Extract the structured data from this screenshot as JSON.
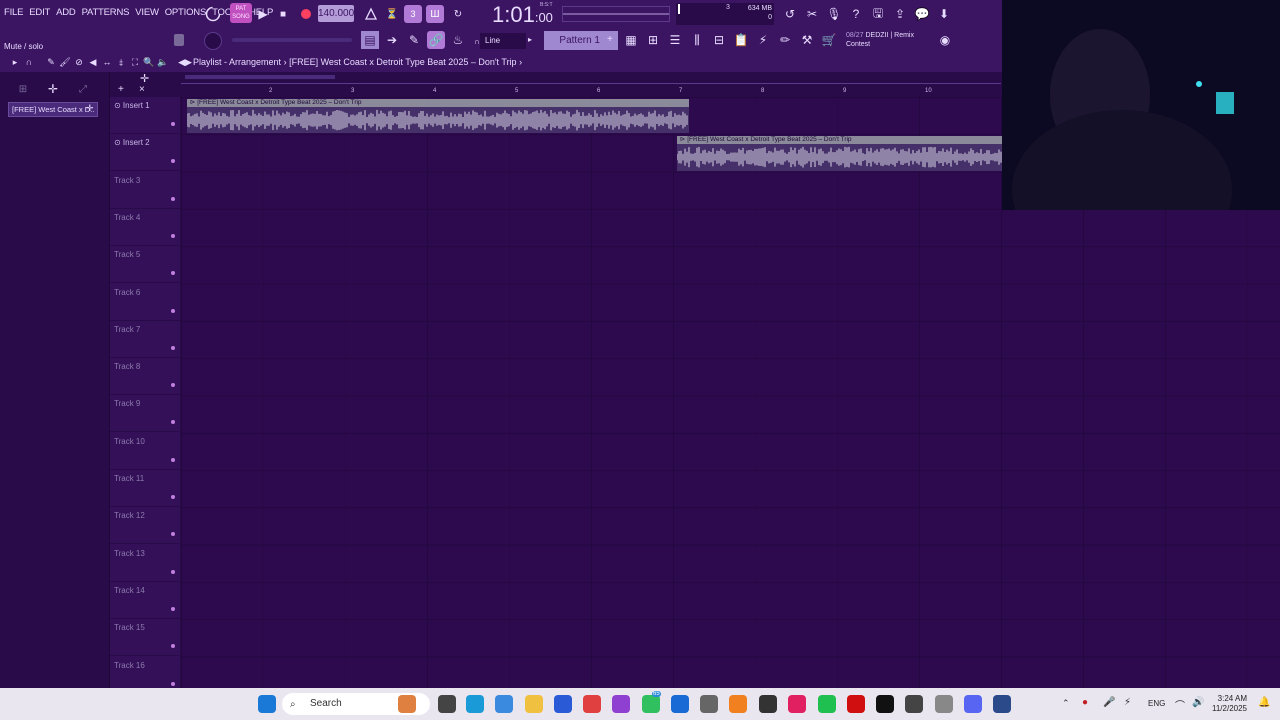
{
  "menu": [
    "FILE",
    "EDIT",
    "ADD",
    "PATTERNS",
    "VIEW",
    "OPTIONS",
    "TOOLS",
    "HELP"
  ],
  "transport": {
    "tempo": "140.000",
    "song_label": "SONG",
    "time_main": "1:01",
    "time_sub": ":00",
    "time_format_label": "B:S:T",
    "pattern_count": "3",
    "voices": "0",
    "memory": "634 MB",
    "memory_sub": "0"
  },
  "hint_bar": {
    "text": "Mute / solo"
  },
  "snap": {
    "label": "Line"
  },
  "pattern_selector": {
    "label": "Pattern 1"
  },
  "news": {
    "date": "08/27",
    "line1": "DEDZII | Remix",
    "line2": "Contest"
  },
  "playlist": {
    "title": "Playlist - Arrangement",
    "breadcrumb_sep": "›",
    "arrangement_name": "[FREE] West Coast x Detroit Type Beat 2025 – Don't Trip",
    "source_clip": "[FREE] West Coast x D..",
    "timeline_ticks": [
      "2",
      "3",
      "4",
      "5",
      "6",
      "7",
      "8",
      "9",
      "10"
    ],
    "tracks": [
      "Insert 1",
      "Insert 2",
      "Track 3",
      "Track 4",
      "Track 5",
      "Track 6",
      "Track 7",
      "Track 8",
      "Track 9",
      "Track 10",
      "Track 11",
      "Track 12",
      "Track 13",
      "Track 14",
      "Track 15",
      "Track 16"
    ],
    "clips": [
      {
        "title": "[FREE] West Coast x Detroit Type Beat 2025 – Don't Trip",
        "track": 1
      },
      {
        "title": "[FREE] West Coast x Detroit Type Beat 2025 – Don't Trip",
        "track": 2
      }
    ]
  },
  "taskbar": {
    "search_label": "Search",
    "language": "ENG",
    "time": "3:24 AM",
    "date": "11/2/2025",
    "badge_count": "65"
  },
  "colors": {
    "background": "#2a0b4a",
    "panel": "#3b1462",
    "clip_body": "#46306a",
    "clip_header": "#8a8a9a",
    "accent": "#b07ad6"
  }
}
